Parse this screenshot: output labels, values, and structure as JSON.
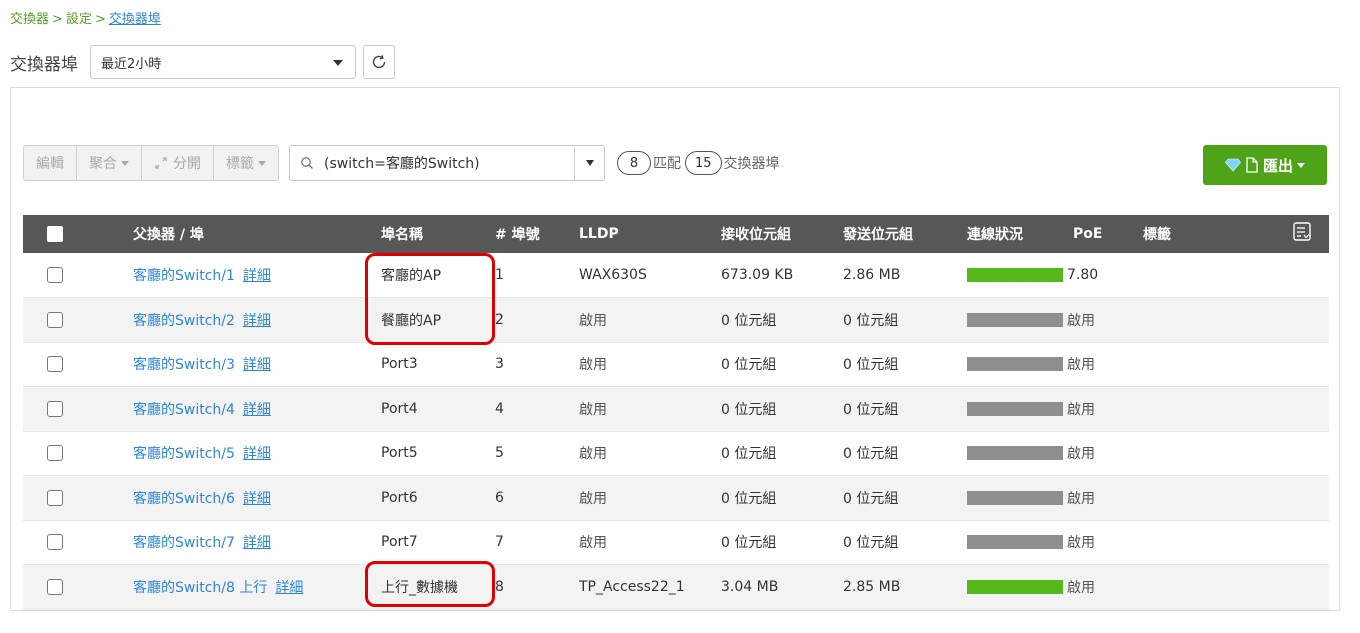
{
  "breadcrumb": {
    "items": [
      "交換器",
      "設定"
    ],
    "current": "交換器埠",
    "separator": ">"
  },
  "page": {
    "title": "交換器埠"
  },
  "time_range": {
    "selected": "最近2小時"
  },
  "toolbar": {
    "edit": "編輯",
    "aggregate": "聚合",
    "split": "分開",
    "tags": "標籤",
    "search_value": "(switch=客廳的Switch)",
    "match_count": "8",
    "match_label": "匹配",
    "port_count": "15",
    "port_label": "交換器埠",
    "export": "匯出"
  },
  "table": {
    "headers": {
      "parent": "父換器 / 埠",
      "port_name": "埠名稱",
      "port_num": "# 埠號",
      "lldp": "LLDP",
      "rx": "接收位元組",
      "tx": "發送位元組",
      "link": "連線狀況",
      "poe": "PoE",
      "tags": "標籤"
    },
    "detail_label": "詳細",
    "rows": [
      {
        "switch": "客廳的Switch/1",
        "name": "客廳的AP",
        "num": "1",
        "lldp": "WAX630S",
        "rx": "673.09 KB",
        "tx": "2.86 MB",
        "link": "up",
        "poe": "7.80"
      },
      {
        "switch": "客廳的Switch/2",
        "name": "餐廳的AP",
        "num": "2",
        "lldp": "啟用",
        "rx": "0 位元組",
        "tx": "0 位元組",
        "link": "down",
        "poe": "啟用"
      },
      {
        "switch": "客廳的Switch/3",
        "name": "Port3",
        "num": "3",
        "lldp": "啟用",
        "rx": "0 位元組",
        "tx": "0 位元組",
        "link": "down",
        "poe": "啟用"
      },
      {
        "switch": "客廳的Switch/4",
        "name": "Port4",
        "num": "4",
        "lldp": "啟用",
        "rx": "0 位元組",
        "tx": "0 位元組",
        "link": "down",
        "poe": "啟用"
      },
      {
        "switch": "客廳的Switch/5",
        "name": "Port5",
        "num": "5",
        "lldp": "啟用",
        "rx": "0 位元組",
        "tx": "0 位元組",
        "link": "down",
        "poe": "啟用"
      },
      {
        "switch": "客廳的Switch/6",
        "name": "Port6",
        "num": "6",
        "lldp": "啟用",
        "rx": "0 位元組",
        "tx": "0 位元組",
        "link": "down",
        "poe": "啟用"
      },
      {
        "switch": "客廳的Switch/7",
        "name": "Port7",
        "num": "7",
        "lldp": "啟用",
        "rx": "0 位元組",
        "tx": "0 位元組",
        "link": "down",
        "poe": "啟用"
      },
      {
        "switch": "客廳的Switch/8 上行",
        "name": "上行_數據機",
        "num": "8",
        "lldp": "TP_Access22_1",
        "rx": "3.04 MB",
        "tx": "2.85 MB",
        "link": "up",
        "poe": "啟用"
      }
    ]
  },
  "colors": {
    "accent_green": "#4ea319",
    "link_blue": "#2f86d6",
    "header_gray": "#575757",
    "highlight_red": "#e00000",
    "link_up": "#56b81b",
    "link_down": "#8f8f8f"
  }
}
